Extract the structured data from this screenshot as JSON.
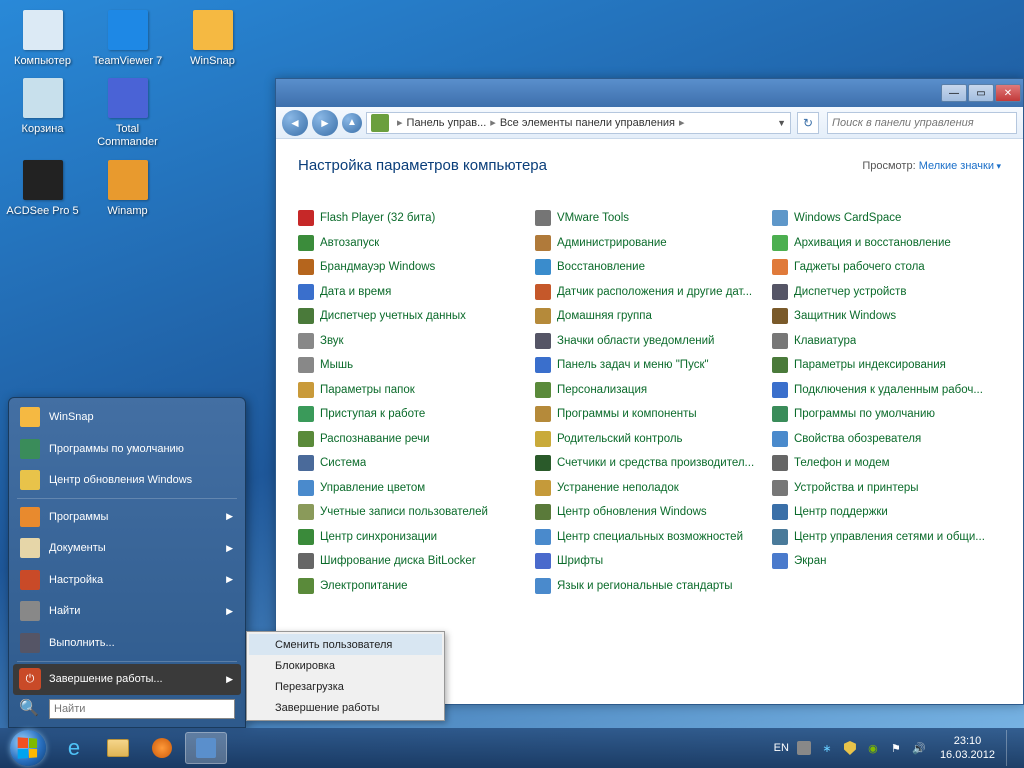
{
  "desktop": {
    "icons": [
      {
        "label": "Компьютер",
        "color": "#dceaf5"
      },
      {
        "label": "TeamViewer 7",
        "color": "#1e88e5"
      },
      {
        "label": "WinSnap",
        "color": "#f5b942"
      },
      {
        "label": "Корзина",
        "color": "#c8e0ec"
      },
      {
        "label": "Total Commander",
        "color": "#4a63d6"
      },
      {
        "label": "",
        "color": "transparent"
      },
      {
        "label": "ACDSee Pro 5",
        "color": "#222"
      },
      {
        "label": "Winamp",
        "color": "#e89a2e"
      }
    ]
  },
  "control_panel": {
    "breadcrumb": [
      "Панель управ...",
      "Все элементы панели управления"
    ],
    "search_placeholder": "Поиск в панели управления",
    "heading": "Настройка параметров компьютера",
    "view_label": "Просмотр:",
    "view_value": "Мелкие значки",
    "items": [
      {
        "label": "Flash Player (32 бита)",
        "c": "#c62828"
      },
      {
        "label": "VMware Tools",
        "c": "#757575"
      },
      {
        "label": "Windows CardSpace",
        "c": "#5e97c9"
      },
      {
        "label": "Автозапуск",
        "c": "#3b8c3b"
      },
      {
        "label": "Администрирование",
        "c": "#b07a3a"
      },
      {
        "label": "Архивация и восстановление",
        "c": "#4caf50"
      },
      {
        "label": "Брандмауэр Windows",
        "c": "#b5651d"
      },
      {
        "label": "Восстановление",
        "c": "#3a8ccc"
      },
      {
        "label": "Гаджеты рабочего стола",
        "c": "#e07a3a"
      },
      {
        "label": "Дата и время",
        "c": "#3a6fcc"
      },
      {
        "label": "Датчик расположения и другие дат...",
        "c": "#c5582a"
      },
      {
        "label": "Диспетчер устройств",
        "c": "#556"
      },
      {
        "label": "Диспетчер учетных данных",
        "c": "#4a7a3a"
      },
      {
        "label": "Домашняя группа",
        "c": "#b58a3a"
      },
      {
        "label": "Защитник Windows",
        "c": "#7a5a2a"
      },
      {
        "label": "Звук",
        "c": "#888"
      },
      {
        "label": "Значки области уведомлений",
        "c": "#556"
      },
      {
        "label": "Клавиатура",
        "c": "#777"
      },
      {
        "label": "Мышь",
        "c": "#888"
      },
      {
        "label": "Панель задач и меню \"Пуск\"",
        "c": "#3a6fcc"
      },
      {
        "label": "Параметры индексирования",
        "c": "#4a7a3a"
      },
      {
        "label": "Параметры папок",
        "c": "#c99a3a"
      },
      {
        "label": "Персонализация",
        "c": "#5a8a3a"
      },
      {
        "label": "Подключения к удаленным рабоч...",
        "c": "#3a6fcc"
      },
      {
        "label": "Приступая к работе",
        "c": "#3a9a5a"
      },
      {
        "label": "Программы и компоненты",
        "c": "#b58a3a"
      },
      {
        "label": "Программы по умолчанию",
        "c": "#3a8c5a"
      },
      {
        "label": "Распознавание речи",
        "c": "#5a8a3a"
      },
      {
        "label": "Родительский контроль",
        "c": "#c9aa3a"
      },
      {
        "label": "Свойства обозревателя",
        "c": "#4a8acc"
      },
      {
        "label": "Система",
        "c": "#4a6a9a"
      },
      {
        "label": "Счетчики и средства производител...",
        "c": "#2a5a2a"
      },
      {
        "label": "Телефон и модем",
        "c": "#666"
      },
      {
        "label": "Управление цветом",
        "c": "#4a8acc"
      },
      {
        "label": "Устранение неполадок",
        "c": "#c59a3a"
      },
      {
        "label": "Устройства и принтеры",
        "c": "#777"
      },
      {
        "label": "Учетные записи пользователей",
        "c": "#8a9a5a"
      },
      {
        "label": "Центр обновления Windows",
        "c": "#5a7a3a"
      },
      {
        "label": "Центр поддержки",
        "c": "#3a6fa8"
      },
      {
        "label": "Центр синхронизации",
        "c": "#3a8a3a"
      },
      {
        "label": "Центр специальных возможностей",
        "c": "#4a8acc"
      },
      {
        "label": "Центр управления сетями и общи...",
        "c": "#4a7a9a"
      },
      {
        "label": "Шифрование диска BitLocker",
        "c": "#666"
      },
      {
        "label": "Шрифты",
        "c": "#4a6acc"
      },
      {
        "label": "Экран",
        "c": "#4a7acc"
      },
      {
        "label": "Электропитание",
        "c": "#5a8a3a"
      },
      {
        "label": "Язык и региональные стандарты",
        "c": "#4a8acc"
      }
    ]
  },
  "start_menu": {
    "items_top": [
      {
        "label": "WinSnap",
        "icon": "winsnap",
        "c": "#f5b942"
      },
      {
        "label": "Программы по умолчанию",
        "icon": "defaults",
        "c": "#3a8c5a"
      },
      {
        "label": "Центр обновления Windows",
        "icon": "update",
        "c": "#e8c34a"
      }
    ],
    "items_mid": [
      {
        "label": "Программы",
        "icon": "programs",
        "c": "#e88a2e",
        "arrow": true
      },
      {
        "label": "Документы",
        "icon": "documents",
        "c": "#e6d6a8",
        "arrow": true
      },
      {
        "label": "Настройка",
        "icon": "settings",
        "c": "#c94a28",
        "arrow": true
      },
      {
        "label": "Найти",
        "icon": "search",
        "c": "#888",
        "arrow": true
      },
      {
        "label": "Выполнить...",
        "icon": "run",
        "c": "#556"
      }
    ],
    "shutdown_label": "Завершение работы...",
    "search_placeholder": "Найти"
  },
  "shutdown_submenu": [
    "Сменить пользователя",
    "Блокировка",
    "Перезагрузка",
    "Завершение работы"
  ],
  "taskbar": {
    "lang": "EN",
    "time": "23:10",
    "date": "16.03.2012"
  }
}
